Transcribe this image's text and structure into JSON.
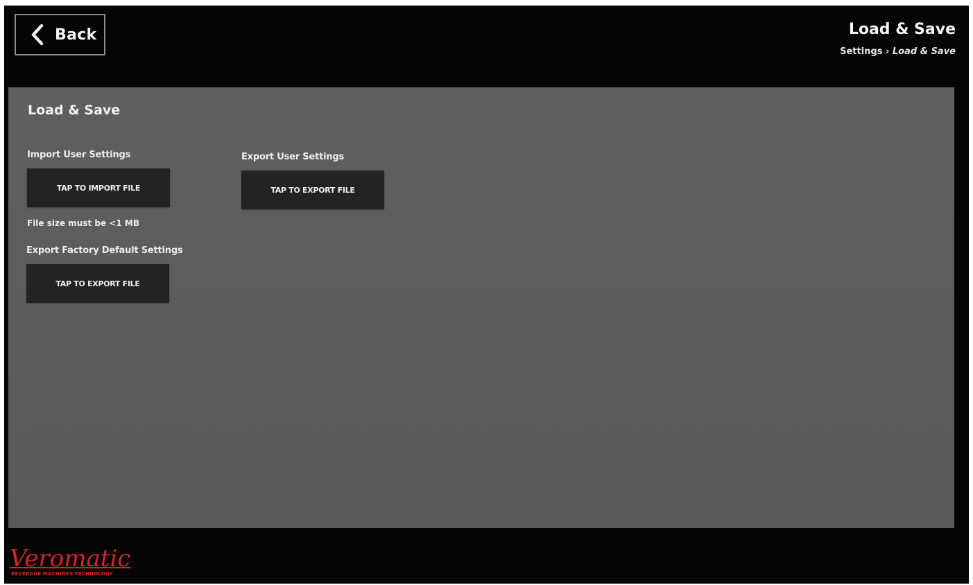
{
  "header": {
    "back_label": "Back",
    "title": "Load & Save",
    "breadcrumb": {
      "parent": "Settings",
      "separator": "›",
      "current": "Load & Save"
    }
  },
  "panel": {
    "title": "Load & Save",
    "import_user": {
      "label": "Import User Settings",
      "button": "TAP TO IMPORT FILE",
      "note": "File size must be <1 MB"
    },
    "export_user": {
      "label": "Export User Settings",
      "button": "TAP TO EXPORT FILE"
    },
    "export_factory": {
      "label": "Export Factory Default Settings",
      "button": "TAP TO EXPORT FILE"
    }
  },
  "footer": {
    "logo_text": "Veromatic",
    "logo_tagline": "BEVERAGE MACHINES TECHNOLOGY"
  },
  "colors": {
    "background": "#050505",
    "panel": "#5c5d5c",
    "button": "#222323",
    "brand": "#d8251f",
    "text": "#f2f2f2"
  },
  "icons": {
    "back": "chevron-left-icon"
  }
}
